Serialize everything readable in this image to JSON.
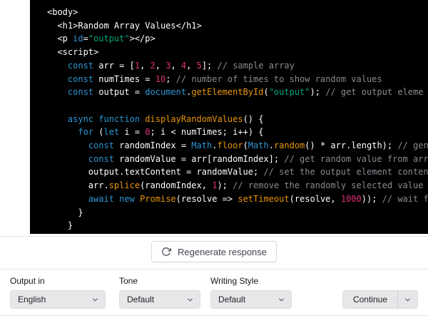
{
  "code": {
    "background": "#000000",
    "palette": {
      "plain": "#ffffff",
      "kw": "#2e95d3",
      "str": "#00a67d",
      "num": "#df3079",
      "fn": "#e9950c",
      "cmt": "#8a8a93"
    },
    "lines": [
      [
        [
          "plain",
          "<body>"
        ]
      ],
      [
        [
          "plain",
          "  <h1>Random Array Values</h1>"
        ]
      ],
      [
        [
          "plain",
          "  <p "
        ],
        [
          "kw",
          "id"
        ],
        [
          "plain",
          "="
        ],
        [
          "str",
          "\"output\""
        ],
        [
          "plain",
          "></p>"
        ]
      ],
      [
        [
          "plain",
          "  <script>"
        ]
      ],
      [
        [
          "plain",
          "    "
        ],
        [
          "kw",
          "const"
        ],
        [
          "plain",
          " arr = ["
        ],
        [
          "num",
          "1"
        ],
        [
          "plain",
          ", "
        ],
        [
          "num",
          "2"
        ],
        [
          "plain",
          ", "
        ],
        [
          "num",
          "3"
        ],
        [
          "plain",
          ", "
        ],
        [
          "num",
          "4"
        ],
        [
          "plain",
          ", "
        ],
        [
          "num",
          "5"
        ],
        [
          "plain",
          "]; "
        ],
        [
          "cmt",
          "// sample array"
        ]
      ],
      [
        [
          "plain",
          "    "
        ],
        [
          "kw",
          "const"
        ],
        [
          "plain",
          " numTimes = "
        ],
        [
          "num",
          "10"
        ],
        [
          "plain",
          "; "
        ],
        [
          "cmt",
          "// number of times to show random values"
        ]
      ],
      [
        [
          "plain",
          "    "
        ],
        [
          "kw",
          "const"
        ],
        [
          "plain",
          " output = "
        ],
        [
          "kw",
          "document"
        ],
        [
          "plain",
          "."
        ],
        [
          "fn",
          "getElementById"
        ],
        [
          "plain",
          "("
        ],
        [
          "str",
          "\"output\""
        ],
        [
          "plain",
          "); "
        ],
        [
          "cmt",
          "// get output eleme"
        ]
      ],
      [],
      [
        [
          "plain",
          "    "
        ],
        [
          "kw",
          "async"
        ],
        [
          "plain",
          " "
        ],
        [
          "kw",
          "function"
        ],
        [
          "plain",
          " "
        ],
        [
          "fn",
          "displayRandomValues"
        ],
        [
          "plain",
          "() {"
        ]
      ],
      [
        [
          "plain",
          "      "
        ],
        [
          "kw",
          "for"
        ],
        [
          "plain",
          " ("
        ],
        [
          "kw",
          "let"
        ],
        [
          "plain",
          " i = "
        ],
        [
          "num",
          "0"
        ],
        [
          "plain",
          "; i < numTimes; i++) {"
        ]
      ],
      [
        [
          "plain",
          "        "
        ],
        [
          "kw",
          "const"
        ],
        [
          "plain",
          " randomIndex = "
        ],
        [
          "kw",
          "Math"
        ],
        [
          "plain",
          "."
        ],
        [
          "fn",
          "floor"
        ],
        [
          "plain",
          "("
        ],
        [
          "kw",
          "Math"
        ],
        [
          "plain",
          "."
        ],
        [
          "fn",
          "random"
        ],
        [
          "plain",
          "() * arr.length); "
        ],
        [
          "cmt",
          "// gen"
        ]
      ],
      [
        [
          "plain",
          "        "
        ],
        [
          "kw",
          "const"
        ],
        [
          "plain",
          " randomValue = arr[randomIndex]; "
        ],
        [
          "cmt",
          "// get random value from arr"
        ]
      ],
      [
        [
          "plain",
          "        output.textContent = randomValue; "
        ],
        [
          "cmt",
          "// set the output element conten"
        ]
      ],
      [
        [
          "plain",
          "        arr."
        ],
        [
          "fn",
          "splice"
        ],
        [
          "plain",
          "(randomIndex, "
        ],
        [
          "num",
          "1"
        ],
        [
          "plain",
          "); "
        ],
        [
          "cmt",
          "// remove the randomly selected value"
        ]
      ],
      [
        [
          "plain",
          "        "
        ],
        [
          "kw",
          "await"
        ],
        [
          "plain",
          " "
        ],
        [
          "kw",
          "new"
        ],
        [
          "fn",
          " Promise"
        ],
        [
          "plain",
          "(resolve => "
        ],
        [
          "fn",
          "setTimeout"
        ],
        [
          "plain",
          "(resolve, "
        ],
        [
          "num",
          "1000"
        ],
        [
          "plain",
          ")); "
        ],
        [
          "cmt",
          "// wait f"
        ]
      ],
      [
        [
          "plain",
          "      }"
        ]
      ],
      [
        [
          "plain",
          "    }"
        ]
      ]
    ]
  },
  "regenerate_button": {
    "label": "Regenerate response"
  },
  "toolbar": {
    "fields": [
      {
        "label": "Output in",
        "value": "English"
      },
      {
        "label": "Tone",
        "value": "Default"
      },
      {
        "label": "Writing Style",
        "value": "Default"
      }
    ],
    "continue": {
      "label": "Continue"
    }
  },
  "icons": {
    "regenerate": "regenerate-icon",
    "chevron": "chevron-down-icon"
  },
  "colors": {
    "code_background": "#000000",
    "divider": "#e5e5e5",
    "button_border": "#d9d9e3",
    "select_background": "#e7e7ea",
    "text_dark": "#202123"
  }
}
